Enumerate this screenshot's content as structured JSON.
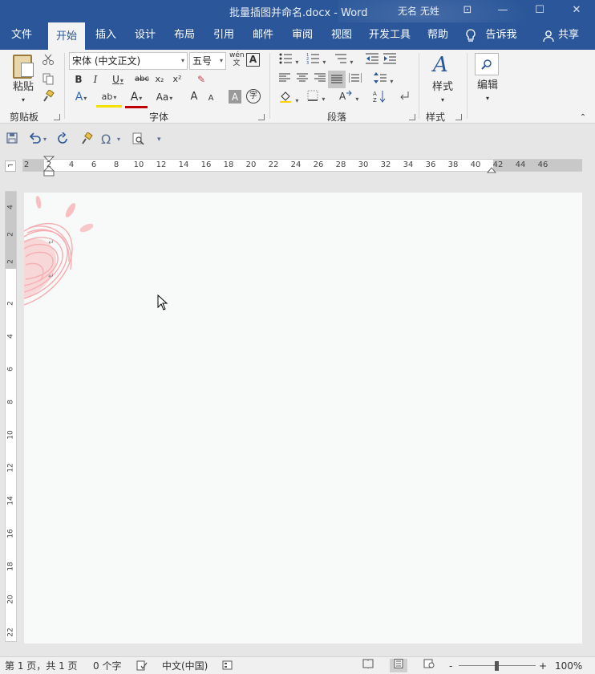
{
  "window": {
    "document_title": "批量插图并命名.docx  -  Word",
    "user": "无名 无姓",
    "controls": {
      "ribbon_display": "⊡",
      "minimize": "—",
      "maximize": "☐",
      "close": "✕"
    }
  },
  "tabs": [
    {
      "label": "文件"
    },
    {
      "label": "开始"
    },
    {
      "label": "插入"
    },
    {
      "label": "设计"
    },
    {
      "label": "布局"
    },
    {
      "label": "引用"
    },
    {
      "label": "邮件"
    },
    {
      "label": "审阅"
    },
    {
      "label": "视图"
    },
    {
      "label": "开发工具"
    },
    {
      "label": "帮助"
    }
  ],
  "tellme": {
    "label": "告诉我"
  },
  "share": {
    "label": "共享"
  },
  "ribbon": {
    "clipboard": {
      "paste": "粘贴",
      "group": "剪贴板"
    },
    "font": {
      "name": "宋体 (中文正文)",
      "size": "五号",
      "phonetic": "wén",
      "bold": "B",
      "italic": "I",
      "underline": "U",
      "strike": "abc",
      "subscript": "x₂",
      "superscript": "x²",
      "effects": "A",
      "highlight": "ab",
      "color": "A",
      "case": "Aa",
      "grow": "A",
      "shrink": "A",
      "shade": "A",
      "enclose": "字",
      "group": "字体"
    },
    "paragraph": {
      "group": "段落"
    },
    "styles": {
      "label": "样式",
      "group": "样式",
      "icon": "A"
    },
    "editing": {
      "label": "编辑"
    }
  },
  "quick_access": {
    "omega": "Ω",
    "more": "▾"
  },
  "ruler": {
    "h_ticks": [
      "2",
      "2",
      "4",
      "6",
      "8",
      "10",
      "12",
      "14",
      "16",
      "18",
      "20",
      "22",
      "24",
      "26",
      "28",
      "30",
      "32",
      "34",
      "36",
      "38",
      "40",
      "42",
      "44",
      "46"
    ],
    "v_ticks": [
      "4",
      "2",
      "2",
      "2",
      "4",
      "6",
      "8",
      "10",
      "12",
      "14",
      "16",
      "18",
      "20",
      "22"
    ]
  },
  "status": {
    "page": "第 1 页，共 1 页",
    "words": "0 个字",
    "language": "中文(中国)",
    "zoom": "100%",
    "zoom_minus": "-",
    "zoom_plus": "+"
  },
  "colors": {
    "title_bar": "#2b579a",
    "ribbon_bg": "#f3f3f3",
    "page_bg": "#f7faf8",
    "doodle": "#f5a3a8"
  }
}
